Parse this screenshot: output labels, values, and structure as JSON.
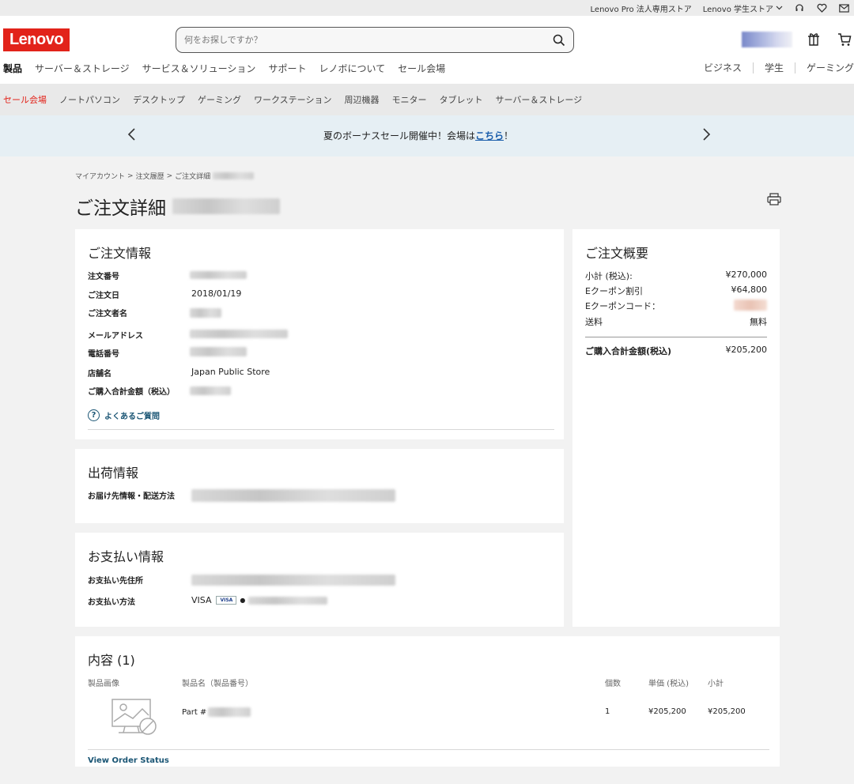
{
  "utility_bar": {
    "links": [
      "Lenovo Pro 法人専用ストア",
      "Lenovo 学生ストア"
    ]
  },
  "header": {
    "logo": "Lenovo",
    "search_placeholder": "何をお探しですか？",
    "main_nav": [
      "製品",
      "サーバー＆ストレージ",
      "サービス＆ソリューション",
      "サポート",
      "レノボについて",
      "セール会場"
    ],
    "right_nav": [
      "ビジネス",
      "学生",
      "ゲーミング"
    ]
  },
  "category_bar": [
    "セール会場",
    "ノートパソコン",
    "デスクトップ",
    "ゲーミング",
    "ワークステーション",
    "周辺機器",
    "モニター",
    "タブレット",
    "サーバー＆ストレージ"
  ],
  "promo": {
    "prefix": "夏のボーナスセール開催中！会場は",
    "link": "こちら",
    "suffix": "！"
  },
  "breadcrumb": {
    "items": [
      "マイアカウント",
      "注文履歴",
      "ご注文詳細"
    ],
    "separator": ">"
  },
  "page_title": "ご注文詳細",
  "order_info": {
    "title": "ご注文情報",
    "labels": {
      "order_number": "注文番号",
      "order_date": "ご注文日",
      "orderer_name": "ご注文者名",
      "email": "メールアドレス",
      "phone": "電話番号",
      "store": "店舗名",
      "total": "ご購入合計金額（税込）"
    },
    "values": {
      "order_date": "2018/01/19",
      "store": "Japan Public Store"
    },
    "faq_link": "よくあるご質問"
  },
  "shipping": {
    "title": "出荷情報",
    "label": "お届け先情報・配送方法"
  },
  "payment": {
    "title": "お支払い情報",
    "address_label": "お支払い先住所",
    "method_label": "お支払い方法",
    "method_value": "VISA",
    "card_badge": "VISA"
  },
  "summary": {
    "title": "ご注文概要",
    "rows": [
      {
        "label": "小計 (税込):",
        "value": "¥270,000"
      },
      {
        "label": "Eクーポン割引",
        "value": "¥64,800"
      },
      {
        "label": "Eクーポンコード：",
        "value": ""
      },
      {
        "label": "送料",
        "value": "無料"
      }
    ],
    "total_label": "ご購入合計金額(税込)",
    "total_value": "¥205,200"
  },
  "contents": {
    "title": "内容 (1)",
    "headers": {
      "image": "製品画像",
      "name": "製品名（製品番号）",
      "qty": "個数",
      "unit_price": "単価 (税込)",
      "subtotal": "小計"
    },
    "item": {
      "part": "Part #",
      "qty": "1",
      "unit_price": "¥205,200",
      "subtotal": "¥205,200"
    },
    "view_status": "View Order Status"
  },
  "colors": {
    "brand_red": "#e2231a",
    "link_blue": "#1a5574",
    "promo_bg": "#e6eff4"
  }
}
